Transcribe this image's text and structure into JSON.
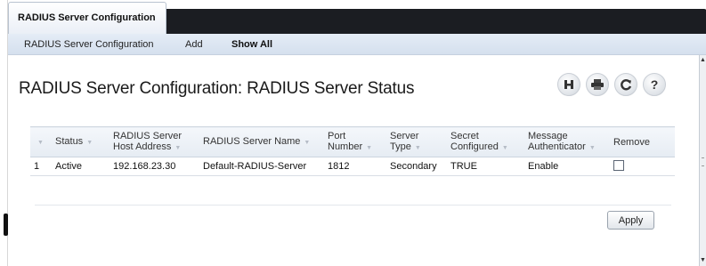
{
  "top_tab": {
    "label": "RADIUS Server Configuration"
  },
  "subnav": {
    "items": [
      {
        "label": "RADIUS Server Configuration",
        "active": false
      },
      {
        "label": "Add",
        "active": false
      },
      {
        "label": "Show All",
        "active": true
      }
    ]
  },
  "page": {
    "title": "RADIUS Server Configuration: RADIUS Server Status"
  },
  "toolbar": {
    "icons": [
      "save-icon",
      "print-icon",
      "refresh-icon",
      "help-icon"
    ],
    "help_glyph": "?"
  },
  "grid": {
    "columns": [
      {
        "label": ""
      },
      {
        "label": "Status"
      },
      {
        "label": "RADIUS Server Host Address"
      },
      {
        "label": "RADIUS Server Name"
      },
      {
        "label": "Port Number"
      },
      {
        "label": "Server Type"
      },
      {
        "label": "Secret Configured"
      },
      {
        "label": "Message Authenticator"
      },
      {
        "label": "Remove"
      }
    ],
    "rows": [
      {
        "index": "1",
        "status": "Active",
        "host": "192.168.23.30",
        "name": "Default-RADIUS-Server",
        "port": "1812",
        "type": "Secondary",
        "secret": "TRUE",
        "msg_auth": "Enable",
        "remove_checked": false
      }
    ]
  },
  "actions": {
    "apply_label": "Apply"
  }
}
